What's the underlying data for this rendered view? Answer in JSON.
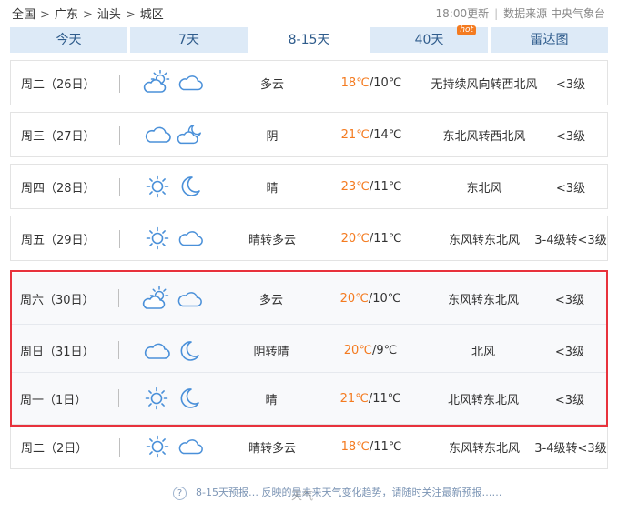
{
  "breadcrumb": [
    "全国",
    "广东",
    "汕头",
    "城区"
  ],
  "breadcrumb_sep": ">",
  "meta": {
    "update_time": "18:00更新",
    "source": "数据来源 中央气象台"
  },
  "tabs": [
    {
      "label": "今天",
      "active": false
    },
    {
      "label": "7天",
      "active": false
    },
    {
      "label": "8-15天",
      "active": true
    },
    {
      "label": "40天",
      "active": false,
      "badge": "hot"
    },
    {
      "label": "雷达图",
      "active": false
    }
  ],
  "forecast": [
    {
      "day": "周二（26日）",
      "icon_day": "partly-cloudy-day-icon",
      "icon_night": "cloudy-icon",
      "weather": "多云",
      "high": "18℃",
      "low": "/10℃",
      "wind": "无持续风向转西北风",
      "level": "<3级"
    },
    {
      "day": "周三（27日）",
      "icon_day": "cloudy-icon",
      "icon_night": "partly-cloudy-night-icon",
      "weather": "阴",
      "high": "21℃",
      "low": "/14℃",
      "wind": "东北风转西北风",
      "level": "<3级"
    },
    {
      "day": "周四（28日）",
      "icon_day": "sun-icon",
      "icon_night": "moon-icon",
      "weather": "晴",
      "high": "23℃",
      "low": "/11℃",
      "wind": "东北风",
      "level": "<3级"
    },
    {
      "day": "周五（29日）",
      "icon_day": "sun-icon",
      "icon_night": "cloudy-icon",
      "weather": "晴转多云",
      "high": "20℃",
      "low": "/11℃",
      "wind": "东风转东北风",
      "level": "3-4级转<3级"
    },
    {
      "day": "周六（30日）",
      "icon_day": "partly-cloudy-day-icon",
      "icon_night": "cloudy-icon",
      "weather": "多云",
      "high": "20℃",
      "low": "/10℃",
      "wind": "东风转东北风",
      "level": "<3级"
    },
    {
      "day": "周日（31日）",
      "icon_day": "cloudy-icon",
      "icon_night": "moon-icon",
      "weather": "阴转晴",
      "high": "20℃",
      "low": "/9℃",
      "wind": "北风",
      "level": "<3级"
    },
    {
      "day": "周一（1日）",
      "icon_day": "sun-icon",
      "icon_night": "moon-icon",
      "weather": "晴",
      "high": "21℃",
      "low": "/11℃",
      "wind": "北风转东北风",
      "level": "<3级"
    },
    {
      "day": "周二（2日）",
      "icon_day": "sun-icon",
      "icon_night": "cloudy-icon",
      "weather": "晴转多云",
      "high": "18℃",
      "low": "/11℃",
      "wind": "东风转东北风",
      "level": "3-4级转<3级"
    }
  ],
  "note": "8-15天预报… 反映的是未来天气变化趋势，请随时关注最新预报……",
  "watermark": "天气",
  "colors": {
    "accent": "#f47b20",
    "tab_bg": "#ddeaf7",
    "tab_text": "#2f5c8c",
    "icon": "#4a90d9",
    "highlight": "#e8323c"
  }
}
